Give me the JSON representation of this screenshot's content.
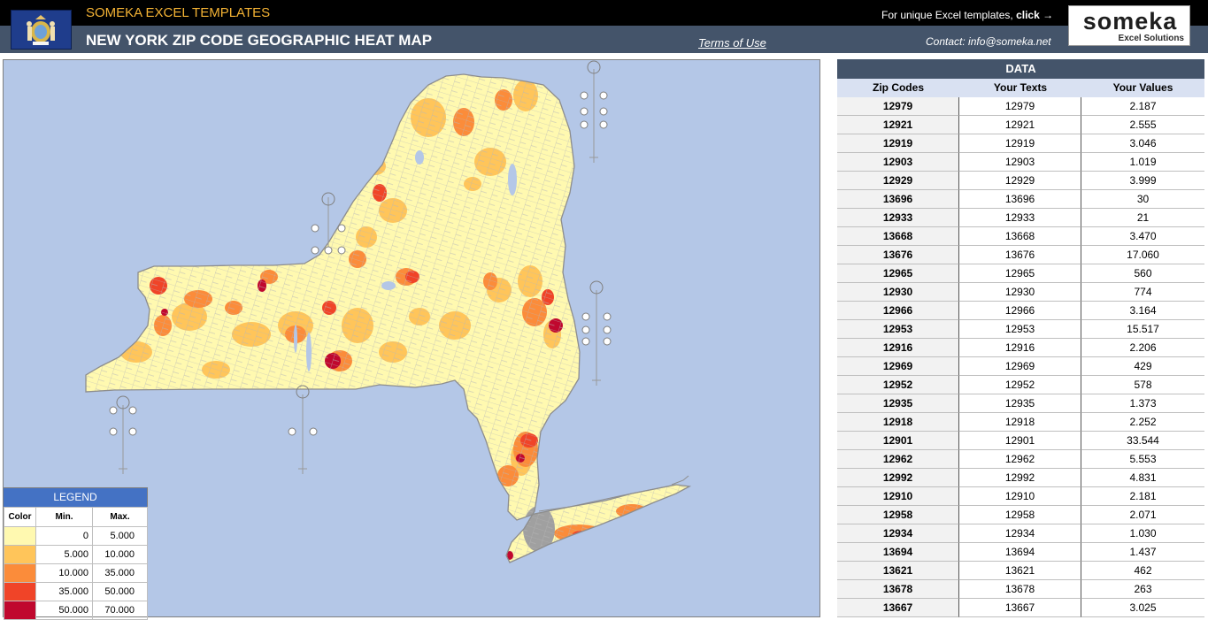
{
  "header": {
    "brand": "SOMEKA EXCEL TEMPLATES",
    "title": "NEW YORK ZIP CODE GEOGRAPHIC HEAT MAP",
    "terms_label": "Terms of Use",
    "promo_text": "For unique Excel templates,",
    "promo_click": "click →",
    "contact": "Contact: info@someka.net",
    "logo_word": "someka",
    "logo_sub": "Excel Solutions"
  },
  "colors": {
    "header_black": "#000000",
    "header_slate": "#44546a",
    "brand_orange": "#f3b234",
    "map_bg": "#b4c7e7",
    "legend_blue": "#4472c4",
    "column_header": "#d9e1f2"
  },
  "legend": {
    "title": "LEGEND",
    "headers": [
      "Color",
      "Min.",
      "Max."
    ],
    "ranges": [
      {
        "color": "#fff9b0",
        "min": "0",
        "max": "5.000"
      },
      {
        "color": "#ffc55a",
        "min": "5.000",
        "max": "10.000"
      },
      {
        "color": "#fb8c3a",
        "min": "10.000",
        "max": "35.000"
      },
      {
        "color": "#f04428",
        "min": "35.000",
        "max": "50.000"
      },
      {
        "color": "#c0082e",
        "min": "50.000",
        "max": "70.000"
      }
    ]
  },
  "data_table": {
    "title": "DATA",
    "columns": [
      "Zip Codes",
      "Your Texts",
      "Your Values"
    ],
    "rows": [
      [
        "12979",
        "12979",
        "2.187"
      ],
      [
        "12921",
        "12921",
        "2.555"
      ],
      [
        "12919",
        "12919",
        "3.046"
      ],
      [
        "12903",
        "12903",
        "1.019"
      ],
      [
        "12929",
        "12929",
        "3.999"
      ],
      [
        "13696",
        "13696",
        "30"
      ],
      [
        "12933",
        "12933",
        "21"
      ],
      [
        "13668",
        "13668",
        "3.470"
      ],
      [
        "13676",
        "13676",
        "17.060"
      ],
      [
        "12965",
        "12965",
        "560"
      ],
      [
        "12930",
        "12930",
        "774"
      ],
      [
        "12966",
        "12966",
        "3.164"
      ],
      [
        "12953",
        "12953",
        "15.517"
      ],
      [
        "12916",
        "12916",
        "2.206"
      ],
      [
        "12969",
        "12969",
        "429"
      ],
      [
        "12952",
        "12952",
        "578"
      ],
      [
        "12935",
        "12935",
        "1.373"
      ],
      [
        "12918",
        "12918",
        "2.252"
      ],
      [
        "12901",
        "12901",
        "33.544"
      ],
      [
        "12962",
        "12962",
        "5.553"
      ],
      [
        "12992",
        "12992",
        "4.831"
      ],
      [
        "12910",
        "12910",
        "2.181"
      ],
      [
        "12958",
        "12958",
        "2.071"
      ],
      [
        "12934",
        "12934",
        "1.030"
      ],
      [
        "13694",
        "13694",
        "1.437"
      ],
      [
        "13621",
        "13621",
        "462"
      ],
      [
        "13678",
        "13678",
        "263"
      ],
      [
        "13667",
        "13667",
        "3.025"
      ]
    ]
  }
}
